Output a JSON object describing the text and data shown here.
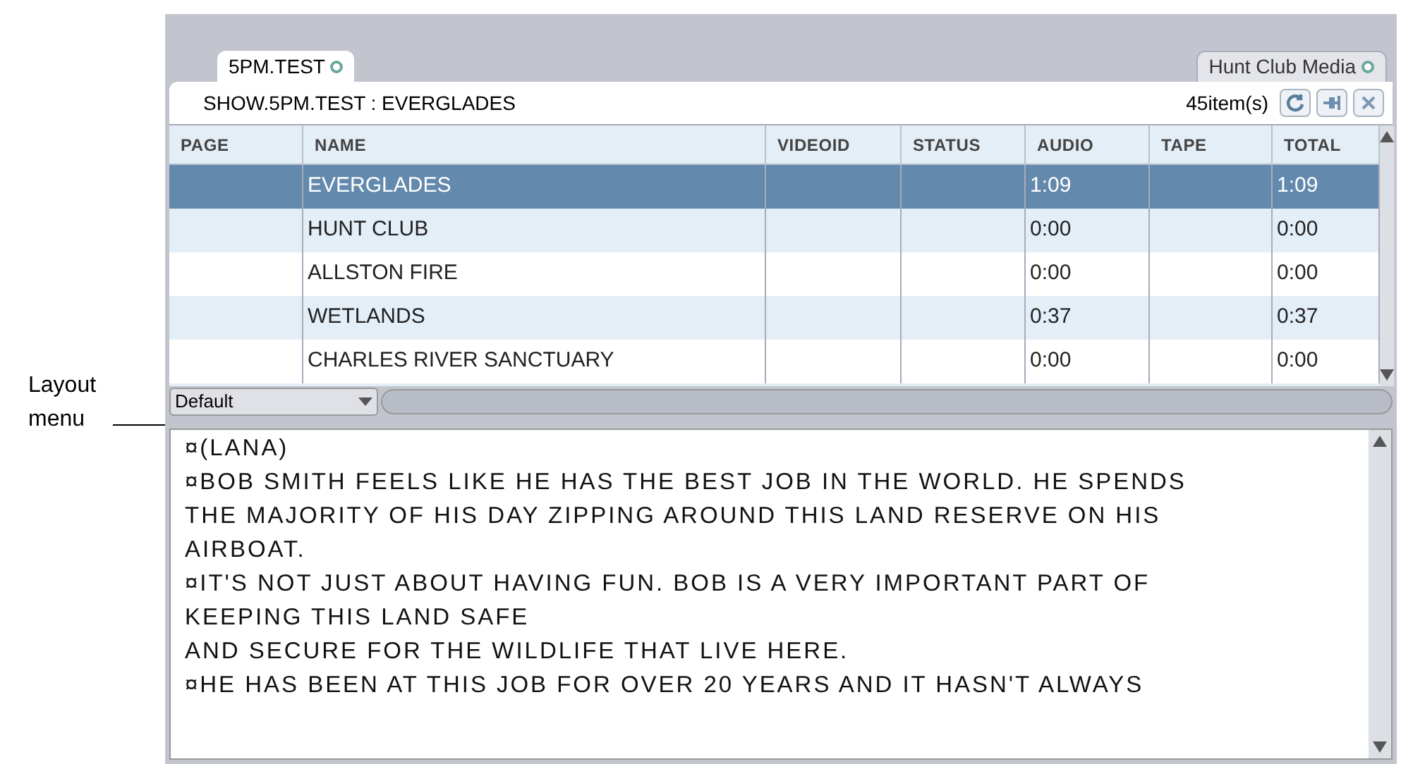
{
  "annotation": {
    "label": "Layout menu"
  },
  "tabs": [
    {
      "label": "5PM.TEST",
      "selected": true
    },
    {
      "label": "Hunt Club Media",
      "selected": false
    }
  ],
  "header": {
    "title": "SHOW.5PM.TEST : EVERGLADES",
    "count": "45item(s)"
  },
  "table": {
    "columns": [
      "PAGE",
      "NAME",
      "VIDEOID",
      "STATUS",
      "AUDIO",
      "TAPE",
      "TOTAL"
    ],
    "rows": [
      {
        "cells": [
          "",
          "EVERGLADES",
          "",
          "",
          "1:09",
          "",
          "1:09"
        ],
        "selected": true
      },
      {
        "cells": [
          "",
          "HUNT CLUB",
          "",
          "",
          "0:00",
          "",
          "0:00"
        ],
        "selected": false
      },
      {
        "cells": [
          "",
          "ALLSTON FIRE",
          "",
          "",
          "0:00",
          "",
          "0:00"
        ],
        "selected": false
      },
      {
        "cells": [
          "",
          "WETLANDS",
          "",
          "",
          "0:37",
          "",
          "0:37"
        ],
        "selected": false
      },
      {
        "cells": [
          "",
          "CHARLES RIVER SANCTUARY",
          "",
          "",
          "0:00",
          "",
          "0:00"
        ],
        "selected": false
      }
    ]
  },
  "layout_menu": {
    "value": "Default"
  },
  "script_lines": [
    "¤(LANA)",
    "¤BOB SMITH FEELS LIKE HE HAS THE BEST JOB IN THE WORLD. HE SPENDS",
    "THE MAJORITY OF HIS DAY ZIPPING AROUND THIS LAND RESERVE ON HIS",
    "AIRBOAT.",
    "¤IT'S NOT JUST ABOUT HAVING FUN. BOB IS A VERY IMPORTANT PART OF",
    "KEEPING THIS LAND SAFE",
    "AND SECURE FOR THE WILDLIFE THAT LIVE HERE.",
    "¤HE HAS BEEN AT THIS JOB FOR OVER 20 YEARS AND IT HASN'T ALWAYS"
  ]
}
